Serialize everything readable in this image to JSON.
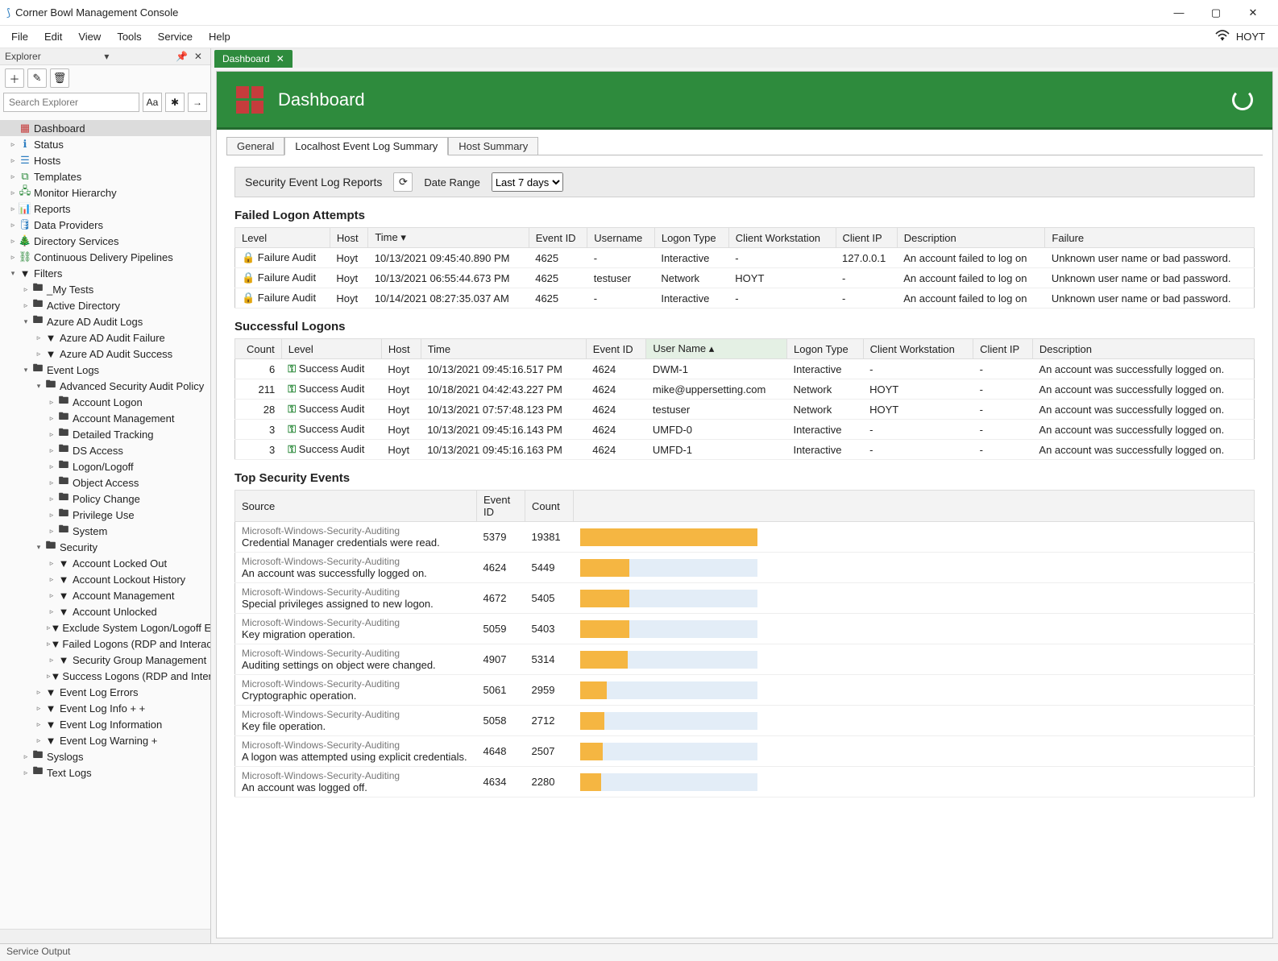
{
  "titlebar": {
    "title": "Corner Bowl Management Console"
  },
  "menu": {
    "file": "File",
    "edit": "Edit",
    "view": "View",
    "tools": "Tools",
    "service": "Service",
    "help": "Help",
    "user": "HOYT"
  },
  "explorer": {
    "title": "Explorer",
    "search_placeholder": "Search Explorer",
    "aa": "Aa"
  },
  "tree": {
    "dashboard": "Dashboard",
    "status": "Status",
    "hosts": "Hosts",
    "templates": "Templates",
    "monitorHierarchy": "Monitor Hierarchy",
    "reports": "Reports",
    "dataProviders": "Data Providers",
    "directoryServices": "Directory Services",
    "cdp": "Continuous Delivery Pipelines",
    "filters": "Filters",
    "myTests": "_My Tests",
    "activeDirectory": "Active Directory",
    "azureAD": "Azure AD Audit Logs",
    "azureADFail": "Azure AD Audit Failure",
    "azureADSuccess": "Azure AD Audit Success",
    "eventLogs": "Event Logs",
    "advSecAudit": "Advanced Security Audit Policy",
    "accountLogon": "Account Logon",
    "accountMgmt": "Account Management",
    "detailedTracking": "Detailed Tracking",
    "dsAccess": "DS Access",
    "logonLogoff": "Logon/Logoff",
    "objectAccess": "Object Access",
    "policyChange": "Policy Change",
    "privilegeUse": "Privilege Use",
    "system": "System",
    "security": "Security",
    "accLockedOut": "Account Locked Out",
    "accLockoutHist": "Account Lockout History",
    "accMgmt2": "Account Management",
    "accUnlocked": "Account Unlocked",
    "exclSysLogon": "Exclude System Logon/Logoff Event",
    "failedLogons": "Failed Logons (RDP and Interactive)",
    "secGroupMgmt": "Security Group Management",
    "successLogons": "Success Logons (RDP and Interactiv",
    "eventLogErrors": "Event Log Errors",
    "eventLogInfoPlus": "Event Log Info + +",
    "eventLogInformation": "Event Log Information",
    "eventLogWarning": "Event Log Warning +",
    "syslogs": "Syslogs",
    "textLogs": "Text Logs"
  },
  "tab": {
    "label": "Dashboard"
  },
  "banner": {
    "title": "Dashboard"
  },
  "subTabs": {
    "general": "General",
    "localhost": "Localhost Event Log Summary",
    "hostSummary": "Host Summary"
  },
  "toolbar": {
    "title": "Security Event Log Reports",
    "dateRange": "Date Range",
    "select": "Last 7 days"
  },
  "failed": {
    "title": "Failed Logon Attempts",
    "h": {
      "level": "Level",
      "host": "Host",
      "time": "Time",
      "eventId": "Event ID",
      "username": "Username",
      "logonType": "Logon Type",
      "clientWs": "Client Workstation",
      "clientIp": "Client IP",
      "description": "Description",
      "failure": "Failure"
    },
    "rows": [
      {
        "level": "Failure Audit",
        "host": "Hoyt",
        "time": "10/13/2021 09:45:40.890 PM",
        "eid": "4625",
        "user": "-",
        "logon": "Interactive",
        "ws": "-",
        "ip": "127.0.0.1",
        "desc": "An account failed to log on",
        "fail": "Unknown user name or bad password."
      },
      {
        "level": "Failure Audit",
        "host": "Hoyt",
        "time": "10/13/2021 06:55:44.673 PM",
        "eid": "4625",
        "user": "testuser",
        "logon": "Network",
        "ws": "HOYT",
        "ip": "-",
        "desc": "An account failed to log on",
        "fail": "Unknown user name or bad password."
      },
      {
        "level": "Failure Audit",
        "host": "Hoyt",
        "time": "10/14/2021 08:27:35.037 AM",
        "eid": "4625",
        "user": "-",
        "logon": "Interactive",
        "ws": "-",
        "ip": "-",
        "desc": "An account failed to log on",
        "fail": "Unknown user name or bad password."
      }
    ]
  },
  "success": {
    "title": "Successful Logons",
    "h": {
      "count": "Count",
      "level": "Level",
      "host": "Host",
      "time": "Time",
      "eventId": "Event ID",
      "username": "User Name",
      "logonType": "Logon Type",
      "clientWs": "Client Workstation",
      "clientIp": "Client IP",
      "description": "Description"
    },
    "rows": [
      {
        "count": "6",
        "level": "Success Audit",
        "host": "Hoyt",
        "time": "10/13/2021 09:45:16.517 PM",
        "eid": "4624",
        "user": "DWM-1",
        "logon": "Interactive",
        "ws": "-",
        "ip": "-",
        "desc": "An account was successfully logged on."
      },
      {
        "count": "211",
        "level": "Success Audit",
        "host": "Hoyt",
        "time": "10/18/2021 04:42:43.227 PM",
        "eid": "4624",
        "user": "mike@uppersetting.com",
        "logon": "Network",
        "ws": "HOYT",
        "ip": "-",
        "desc": "An account was successfully logged on."
      },
      {
        "count": "28",
        "level": "Success Audit",
        "host": "Hoyt",
        "time": "10/13/2021 07:57:48.123 PM",
        "eid": "4624",
        "user": "testuser",
        "logon": "Network",
        "ws": "HOYT",
        "ip": "-",
        "desc": "An account was successfully logged on."
      },
      {
        "count": "3",
        "level": "Success Audit",
        "host": "Hoyt",
        "time": "10/13/2021 09:45:16.143 PM",
        "eid": "4624",
        "user": "UMFD-0",
        "logon": "Interactive",
        "ws": "-",
        "ip": "-",
        "desc": "An account was successfully logged on."
      },
      {
        "count": "3",
        "level": "Success Audit",
        "host": "Hoyt",
        "time": "10/13/2021 09:45:16.163 PM",
        "eid": "4624",
        "user": "UMFD-1",
        "logon": "Interactive",
        "ws": "-",
        "ip": "-",
        "desc": "An account was successfully logged on."
      }
    ]
  },
  "top": {
    "title": "Top Security Events",
    "h": {
      "source": "Source",
      "eventId": "Event ID",
      "count": "Count"
    },
    "src": "Microsoft-Windows-Security-Auditing",
    "rows": [
      {
        "desc": "Credential Manager credentials were read.",
        "eid": "5379",
        "count": "19381",
        "pct": 100
      },
      {
        "desc": "An account was successfully logged on.",
        "eid": "4624",
        "count": "5449",
        "pct": 28
      },
      {
        "desc": "Special privileges assigned to new logon.",
        "eid": "4672",
        "count": "5405",
        "pct": 28
      },
      {
        "desc": "Key migration operation.",
        "eid": "5059",
        "count": "5403",
        "pct": 28
      },
      {
        "desc": "Auditing settings on object were changed.",
        "eid": "4907",
        "count": "5314",
        "pct": 27
      },
      {
        "desc": "Cryptographic operation.",
        "eid": "5061",
        "count": "2959",
        "pct": 15
      },
      {
        "desc": "Key file operation.",
        "eid": "5058",
        "count": "2712",
        "pct": 14
      },
      {
        "desc": "A logon was attempted using explicit credentials.",
        "eid": "4648",
        "count": "2507",
        "pct": 13
      },
      {
        "desc": "An account was logged off.",
        "eid": "4634",
        "count": "2280",
        "pct": 12
      }
    ]
  },
  "chart_data": {
    "type": "bar",
    "title": "Top Security Events",
    "categories": [
      5379,
      4624,
      4672,
      5059,
      4907,
      5061,
      5058,
      4648,
      4634
    ],
    "values": [
      19381,
      5449,
      5405,
      5403,
      5314,
      2959,
      2712,
      2507,
      2280
    ]
  },
  "status": {
    "label": "Service Output"
  }
}
